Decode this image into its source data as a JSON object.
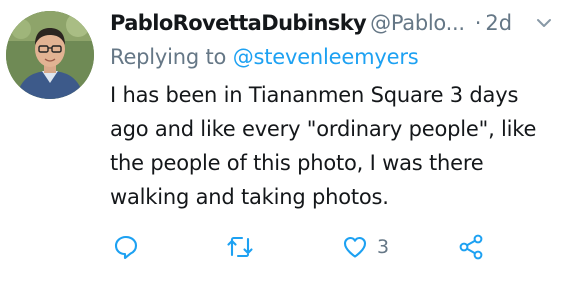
{
  "tweet": {
    "author_name": "PabloRovettaDubinsky",
    "author_handle": "@Pablo...",
    "separator": "·",
    "time_ago": "2d",
    "replying_to_prefix": "Replying to",
    "replying_to_handle": "@stevenleemyers",
    "text_lines": [
      "I  has been in Tiananmen Square 3 days",
      "ago and like every \"ordinary people\", like",
      "the people of this photo, I was there",
      "walking and taking photos."
    ],
    "actions": {
      "reply_count": "",
      "retweet_count": "",
      "like_count": "3"
    }
  },
  "colors": {
    "text": "#14171a",
    "secondary": "#657786",
    "link": "#1da1f2",
    "icon": "#1da1f2"
  },
  "icons": {
    "caret": "chevron-down-icon",
    "reply": "reply-icon",
    "retweet": "retweet-icon",
    "like": "heart-icon",
    "share": "share-icon"
  }
}
